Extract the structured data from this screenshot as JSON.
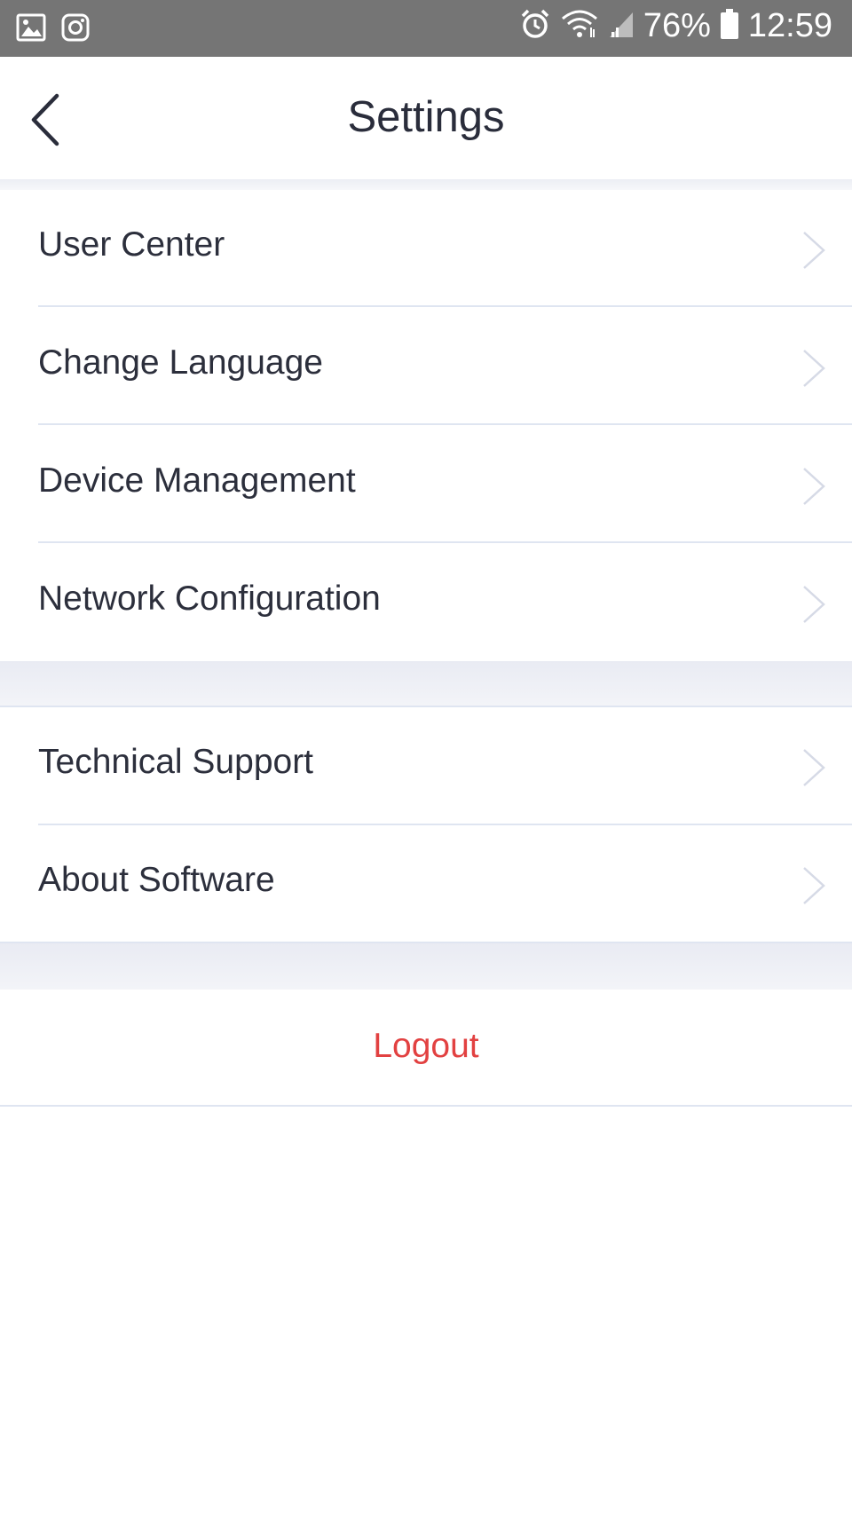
{
  "status_bar": {
    "battery": "76%",
    "time": "12:59",
    "icons": [
      "gallery-icon",
      "instagram-icon",
      "alarm-icon",
      "wifi-icon",
      "signal-icon",
      "battery-icon"
    ]
  },
  "header": {
    "title": "Settings",
    "back_icon": "chevron-left-icon"
  },
  "section1": [
    {
      "label": "User Center"
    },
    {
      "label": "Change Language"
    },
    {
      "label": "Device Management"
    },
    {
      "label": "Network Configuration"
    }
  ],
  "section2": [
    {
      "label": "Technical Support"
    },
    {
      "label": "About Software"
    }
  ],
  "logout": {
    "label": "Logout",
    "color": "#e24141"
  },
  "colors": {
    "status_bar": "#757575",
    "text": "#2c2f3c",
    "divider": "#dfe5f1",
    "section_gap": "#eceef4",
    "accent_red": "#e24141"
  }
}
